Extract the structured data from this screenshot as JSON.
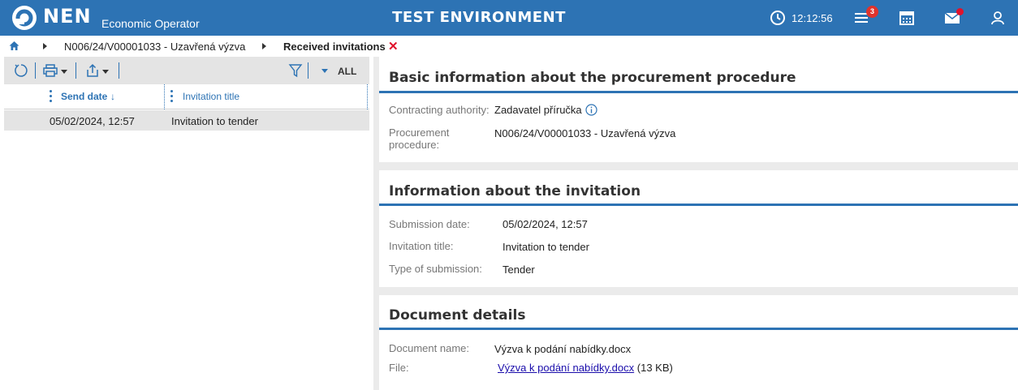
{
  "header": {
    "logo_text": "NEN",
    "logo_subtitle": "Economic Operator",
    "environment": "TEST ENVIRONMENT",
    "time": "12:12:56",
    "notifications_count": "3",
    "colors": {
      "bar": "#2d73b4",
      "badge": "#e0332c"
    },
    "icons": [
      "clock-icon",
      "menu-icon",
      "calendar-icon",
      "mail-icon",
      "user-icon"
    ]
  },
  "breadcrumb": {
    "items": [
      "N006/24/V00001033 - Uzavřená výzva",
      "Received invitations"
    ]
  },
  "toolbar": {
    "filter_label": "ALL"
  },
  "grid": {
    "columns": [
      "Send date",
      "Invitation title"
    ],
    "rows": [
      {
        "send_date": "05/02/2024, 12:57",
        "title": "Invitation to tender"
      }
    ]
  },
  "basic_info": {
    "title": "Basic information about the procurement procedure",
    "authority_label": "Contracting authority:",
    "authority_value": "Zadavatel příručka",
    "procedure_label_1": "Procurement",
    "procedure_label_2": "procedure:",
    "procedure_value": "N006/24/V00001033 - Uzavřená výzva"
  },
  "invitation_info": {
    "title": "Information about the invitation",
    "submission_date_label": "Submission date:",
    "submission_date_value": "05/02/2024, 12:57",
    "invitation_title_label": "Invitation title:",
    "invitation_title_value": "Invitation to tender",
    "submission_type_label": "Type of submission:",
    "submission_type_value": "Tender"
  },
  "document_details": {
    "title": "Document details",
    "name_label": "Document name:",
    "name_value": "Výzva k podání nabídky.docx",
    "file_label": "File:",
    "file_link": "Výzva k podání nabídky.docx",
    "file_size": "(13 KB)"
  }
}
